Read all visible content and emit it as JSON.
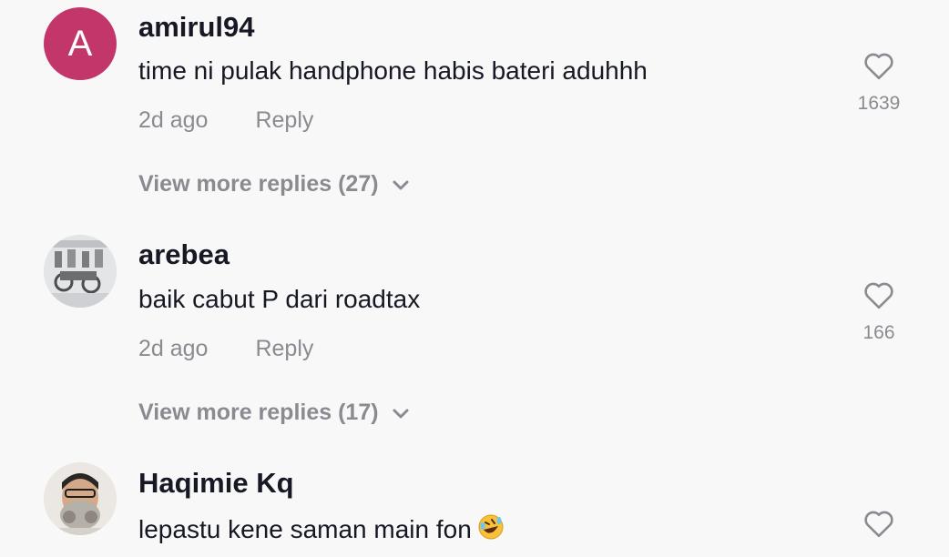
{
  "comments": [
    {
      "avatar_letter": "A",
      "username": "amirul94",
      "text": "time ni pulak handphone habis bateri aduhhh",
      "time": "2d ago",
      "reply_label": "Reply",
      "likes": "1639",
      "view_more": "View more replies (27)"
    },
    {
      "username": "arebea",
      "text": "baik cabut P dari roadtax",
      "time": "2d ago",
      "reply_label": "Reply",
      "likes": "166",
      "view_more": "View more replies (17)"
    },
    {
      "username": "Haqimie Kq",
      "text": "lepastu kene saman main fon",
      "emoji": "rolling-on-floor-laughing"
    }
  ],
  "colors": {
    "avatar_a": "#c2366a",
    "text_primary": "#161823",
    "text_secondary": "#8a8b91",
    "background": "#f8f8f8"
  }
}
